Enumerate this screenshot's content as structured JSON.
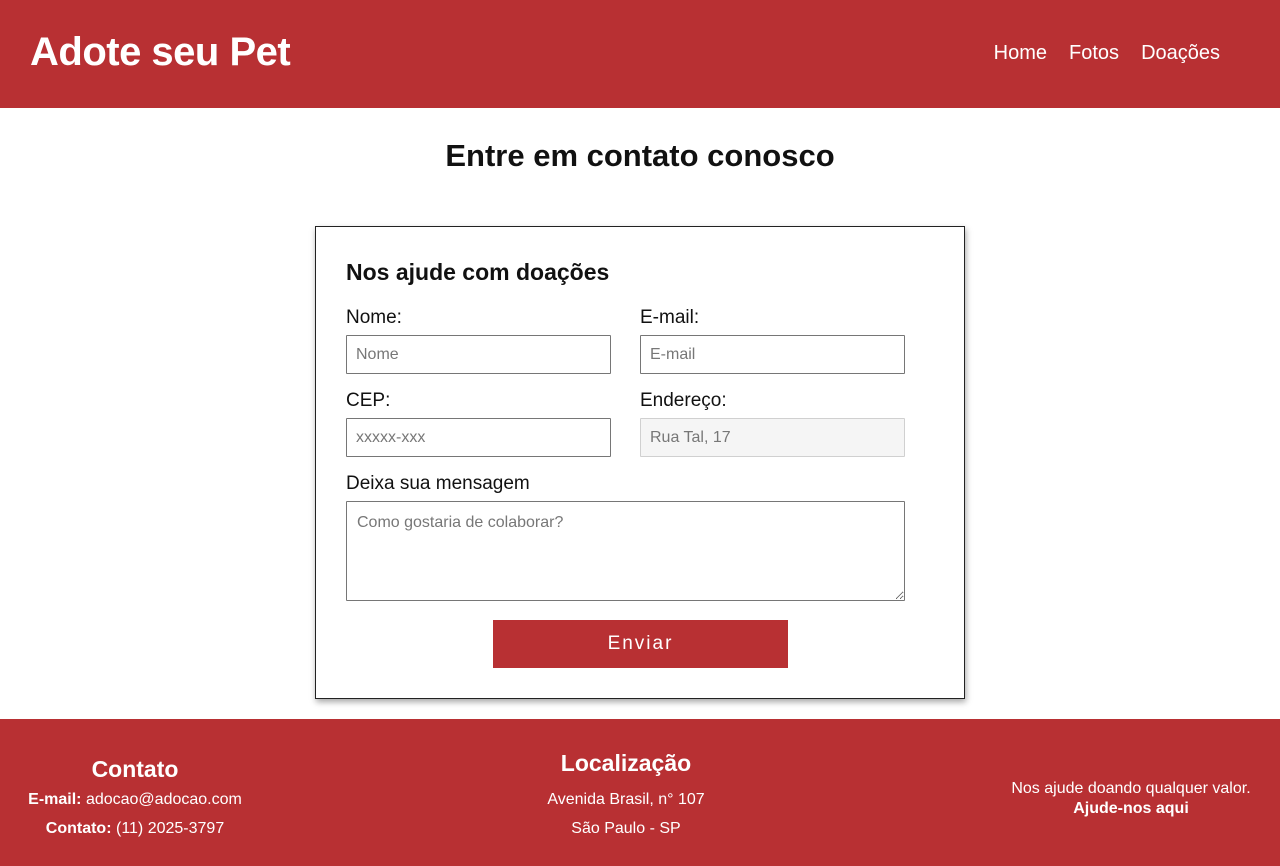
{
  "header": {
    "brand": "Adote seu Pet",
    "nav": [
      "Home",
      "Fotos",
      "Doações"
    ]
  },
  "page_title": "Entre em contato conosco",
  "form": {
    "title": "Nos ajude com doações",
    "nome_label": "Nome:",
    "nome_placeholder": "Nome",
    "email_label": "E-mail:",
    "email_placeholder": "E-mail",
    "cep_label": "CEP:",
    "cep_placeholder": "xxxxx-xxx",
    "endereco_label": "Endereço:",
    "endereco_placeholder": "Rua Tal, 17",
    "mensagem_label": "Deixa sua mensagem",
    "mensagem_placeholder": "Como gostaria de colaborar?",
    "submit_label": "Enviar"
  },
  "footer": {
    "contato": {
      "title": "Contato",
      "email_label": "E-mail:",
      "email_value": "adocao@adocao.com",
      "phone_label": "Contato:",
      "phone_value": "(11) 2025-3797"
    },
    "localizacao": {
      "title": "Localização",
      "address": "Avenida Brasil, n° 107",
      "city": "São Paulo - SP"
    },
    "help": {
      "text": "Nos ajude doando qualquer valor.",
      "link": "Ajude-nos aqui"
    }
  },
  "colors": {
    "brand_red": "#b83033",
    "text_dark": "#111111",
    "white": "#ffffff"
  }
}
